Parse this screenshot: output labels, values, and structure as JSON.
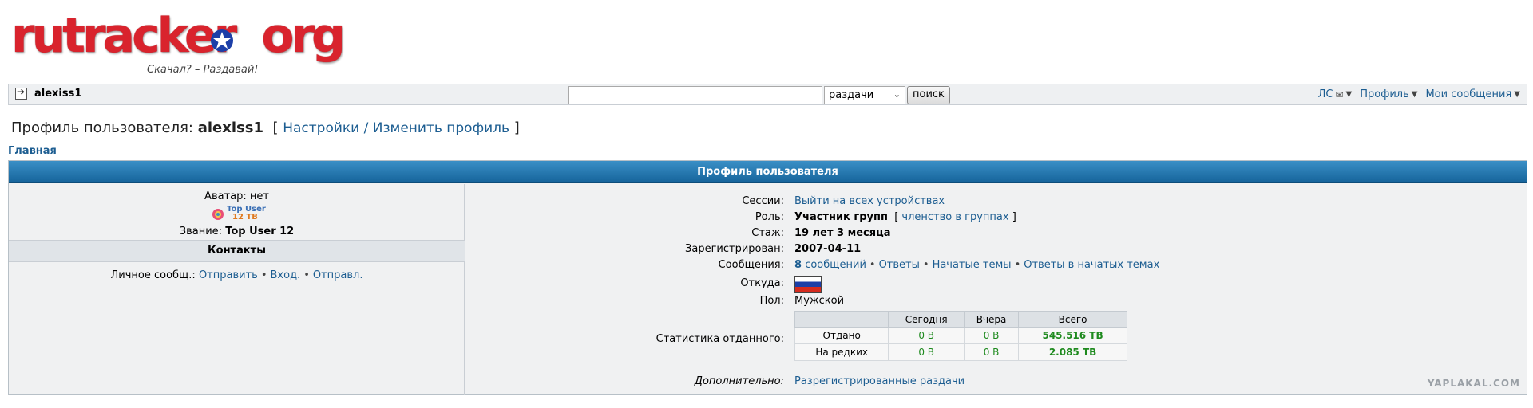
{
  "logo": {
    "word": "rutracker",
    "org": "org",
    "tagline": "Скачал? – Раздавай!"
  },
  "topbar": {
    "username": "alexiss1",
    "search_placeholder": "",
    "search_scope": "раздачи",
    "search_button": "поиск",
    "nav": [
      {
        "label": "ЛС"
      },
      {
        "label": "Профиль"
      },
      {
        "label": "Мои сообщения"
      }
    ]
  },
  "title": {
    "prefix": "Профиль пользователя:",
    "username": "alexiss1",
    "link": "Настройки / Изменить профиль"
  },
  "breadcrumb": "Главная",
  "profile": {
    "header": "Профиль пользователя",
    "avatar_label": "Аватар: нет",
    "badge": {
      "line1": "Top User",
      "line2": "12 TB"
    },
    "rank_label": "Звание:",
    "rank_value": "Top User 12",
    "contacts_header": "Контакты",
    "pm_label": "Личное сообщ.:",
    "pm_links": [
      "Отправить",
      "Вход.",
      "Отправл."
    ],
    "fields": {
      "sessions_label": "Сессии:",
      "sessions_value": "Выйти на всех устройствах",
      "role_label": "Роль:",
      "role_value": "Участник групп",
      "role_link": "членство в группах",
      "exp_label": "Стаж:",
      "exp_value": "19 лет 3 месяца",
      "reg_label": "Зарегистрирован:",
      "reg_value": "2007-04-11",
      "posts_label": "Сообщения:",
      "posts_count": "8",
      "posts_word": "сообщений",
      "posts_links": [
        "Ответы",
        "Начатые темы",
        "Ответы в начатых темах"
      ],
      "from_label": "Откуда:",
      "gender_label": "Пол:",
      "gender_value": "Мужской",
      "stats_label": "Статистика отданного:",
      "extra_label": "Дополнительно:",
      "extra_value": "Разрегистрированные раздачи"
    },
    "stats": {
      "headers": [
        "",
        "Сегодня",
        "Вчера",
        "Всего"
      ],
      "rows": [
        {
          "name": "Отдано",
          "today": "0 B",
          "yesterday": "0 B",
          "total": "545.516 TB"
        },
        {
          "name": "На редких",
          "today": "0 B",
          "yesterday": "0 B",
          "total": "2.085 TB"
        }
      ]
    }
  },
  "watermark": "YAPLAKAL.COM",
  "colors": {
    "link": "#1c5d91",
    "header_blue": "#16649b",
    "logo_red": "#d9232d",
    "stat_green": "#1e8a1e"
  }
}
